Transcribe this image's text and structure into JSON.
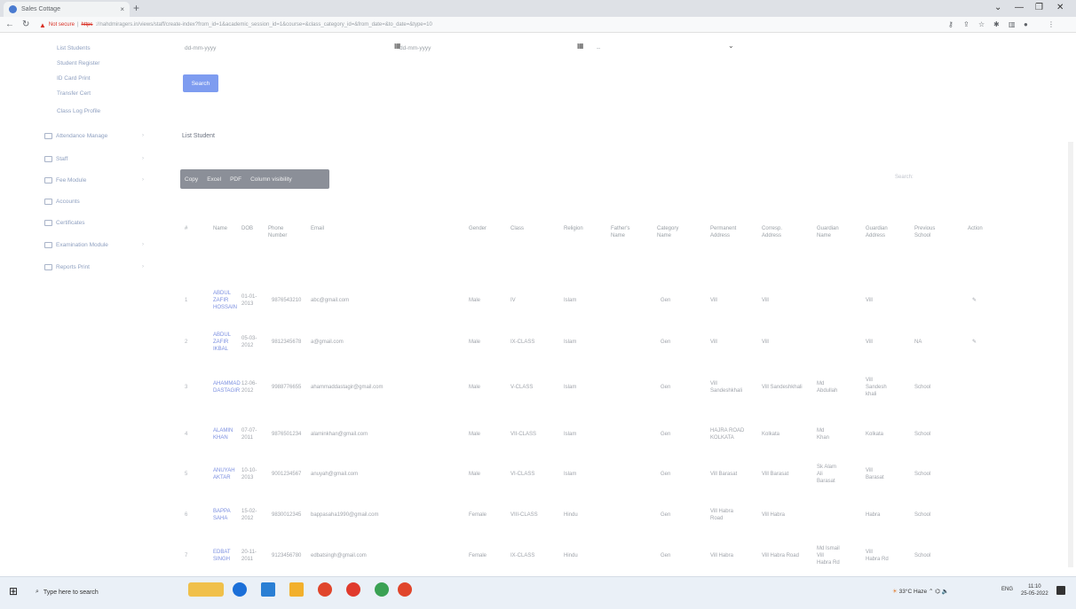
{
  "browser": {
    "tab_title": "Sales Cottage",
    "url_warning": "Not secure",
    "url_scheme": "https",
    "url_rest": "://nahdmiragers.in/views/staff/create-index?from_id=1&academic_session_id=1&course=&class_category_id=&from_date=&to_date=&type=10"
  },
  "sidebar": {
    "sub_items": [
      "List Students",
      "Student Register",
      "ID Card Print",
      "Transfer Cert",
      "Class Log Profile"
    ],
    "items": [
      "Attendance Manage",
      "Staff",
      "Fee Module",
      "Accounts",
      "Certificates",
      "Examination Module",
      "Reports Print"
    ]
  },
  "filters": {
    "from_date": "dd-mm-yyyy",
    "to_date": "dd-mm-yyyy",
    "select": "--"
  },
  "search_button": "Search",
  "list_title": "List Student",
  "export_buttons": [
    "Copy",
    "Excel",
    "PDF",
    "Column visibility"
  ],
  "table_search": "Search:",
  "table": {
    "headers": [
      "#",
      "Name",
      "DOB",
      "Phone Number",
      "Email",
      "Gender",
      "Class",
      "Religion",
      "Father's Name",
      "Category Name",
      "Permanent Address",
      "Corresp. Address",
      "Guardian Name",
      "Guardian Address",
      "Previous School",
      "Action"
    ],
    "rows": [
      {
        "sr": "1",
        "name": "ABDUL\nZAFIR\nHOSSAIN",
        "dob": "01-01-\n2013",
        "phone": "9876543210",
        "email": "abc@gmail.com",
        "gender": "Male",
        "class": "IV",
        "religion": "Islam",
        "father": "",
        "category": "Gen",
        "perm": "Vill",
        "corr": "Vill",
        "guardian": "",
        "gaddr": "Vill",
        "prev": "",
        "action": "✎"
      },
      {
        "sr": "2",
        "name": "ABDUL\nZAFIR\nIKBAL",
        "dob": "05-03-\n2012",
        "phone": "9812345678",
        "email": "a@gmail.com",
        "gender": "Male",
        "class": "IX-CLASS",
        "religion": "Islam",
        "father": "",
        "category": "Gen",
        "perm": "Vill",
        "corr": "Vill",
        "guardian": "",
        "gaddr": "Vill",
        "prev": "NA",
        "action": "✎"
      },
      {
        "sr": "3",
        "name": "AHAMMAD\nDASTAGIR",
        "dob": "12-06-\n2012",
        "phone": "9988776655",
        "email": "ahammaddastagir@gmail.com",
        "gender": "Male",
        "class": "V-CLASS",
        "religion": "Islam",
        "father": "",
        "category": "Gen",
        "perm": "Vill\nSandeshkhali",
        "corr": "Vill Sandeshkhali",
        "guardian": "Md\nAbdullah",
        "gaddr": "Vill\nSandesh\nkhali",
        "prev": "School",
        "action": ""
      },
      {
        "sr": "4",
        "name": "ALAMIN\nKHAN",
        "dob": "07-07-\n2011",
        "phone": "9876501234",
        "email": "alaminkhan@gmail.com",
        "gender": "Male",
        "class": "VII-CLASS",
        "religion": "Islam",
        "father": "",
        "category": "Gen",
        "perm": "HAJRA ROAD\nKOLKATA",
        "corr": "Kolkata",
        "guardian": "Md\nKhan",
        "gaddr": "Kolkata",
        "prev": "School",
        "action": ""
      },
      {
        "sr": "5",
        "name": "ANUYAH\nAKTAR",
        "dob": "10-10-\n2013",
        "phone": "9001234567",
        "email": "anuyah@gmail.com",
        "gender": "Male",
        "class": "VI-CLASS",
        "religion": "Islam",
        "father": "",
        "category": "Gen",
        "perm": "Vill Barasat",
        "corr": "Vill Barasat",
        "guardian": "Sk Alam\nAli\nBarasat",
        "gaddr": "Vill\nBarasat",
        "prev": "School",
        "action": ""
      },
      {
        "sr": "6",
        "name": "BAPPA\nSAHA",
        "dob": "15-02-\n2012",
        "phone": "9830012345",
        "email": "bappasaha1990@gmail.com",
        "gender": "Female",
        "class": "VIII-CLASS",
        "religion": "Hindu",
        "father": "",
        "category": "Gen",
        "perm": "Vill Habra\nRoad",
        "corr": "Vill Habra",
        "guardian": "",
        "gaddr": "Habra",
        "prev": "School",
        "action": ""
      },
      {
        "sr": "7",
        "name": "EDBAT\nSINGH",
        "dob": "20-11-\n2011",
        "phone": "9123456780",
        "email": "edbatsingh@gmail.com",
        "gender": "Female",
        "class": "IX-CLASS",
        "religion": "Hindu",
        "father": "",
        "category": "Gen",
        "perm": "Vill Habra",
        "corr": "Vill Habra Road",
        "guardian": "Md Ismail\nVill\nHabra Rd",
        "gaddr": "Vill\nHabra Rd",
        "prev": "School",
        "action": ""
      }
    ]
  },
  "taskbar": {
    "search_placeholder": "Type here to search",
    "weather": "33°C Haze",
    "lang": "ENG",
    "time": "11:10",
    "date": "25-05-2022"
  },
  "colors": {
    "primary_button": "#7e9cf0",
    "export_bg": "#8b8f98",
    "link": "#7b8fe0",
    "insecure": "#d93025"
  }
}
